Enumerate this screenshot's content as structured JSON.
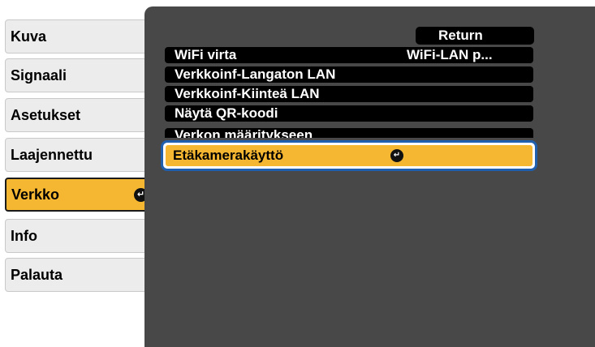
{
  "sidebar": {
    "items": [
      {
        "label": "Kuva"
      },
      {
        "label": "Signaali"
      },
      {
        "label": "Asetukset"
      },
      {
        "label": "Laajennettu"
      },
      {
        "label": "Verkko",
        "selected": true
      },
      {
        "label": "Info"
      },
      {
        "label": "Palauta"
      }
    ]
  },
  "menu": {
    "return_label": "Return",
    "items": [
      {
        "label": "WiFi virta",
        "value": "WiFi-LAN p..."
      },
      {
        "label": "Verkkoinf-Langaton LAN"
      },
      {
        "label": "Verkkoinf-Kiinteä LAN"
      },
      {
        "label": "Näytä QR-koodi"
      },
      {
        "label": "Verkon määritykseen"
      }
    ],
    "selected_item": {
      "label": "Etäkamerakäyttö"
    }
  },
  "icons": {
    "enter": "enter-return-icon"
  },
  "colors": {
    "panel_background": "#484848",
    "selected_fill": "#f5b731",
    "selection_border": "#1f5fae",
    "tab_background": "#ececec",
    "row_background": "#000000"
  }
}
